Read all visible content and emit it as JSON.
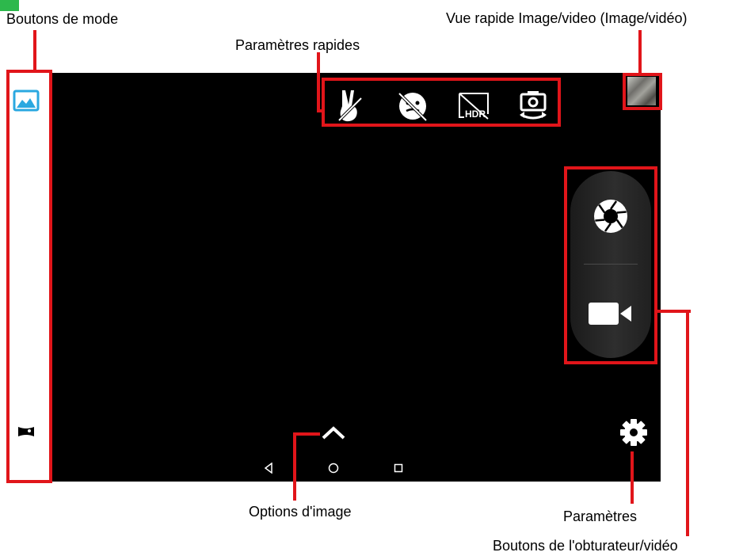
{
  "labels": {
    "mode_buttons": "Boutons de mode",
    "quick_view": "Vue rapide Image/video (Image/vidéo)",
    "quick_settings": "Paramètres rapides",
    "image_options": "Options d'image",
    "settings": "Paramètres",
    "shutter_video": "Boutons de l'obturateur/vidéo"
  },
  "mode_buttons": [
    "image-mode-icon",
    "beauty-mode-icon",
    "panorama-mode-icon"
  ],
  "quick_settings": [
    "gesture-icon",
    "smile-off-icon",
    "hdr-off-icon",
    "switch-camera-icon"
  ],
  "nav_bar": [
    "back-icon",
    "home-icon",
    "recents-icon"
  ],
  "colors": {
    "annotation": "#e1151a",
    "active_mode": "#2aa8e0",
    "viewfinder": "#000000"
  }
}
